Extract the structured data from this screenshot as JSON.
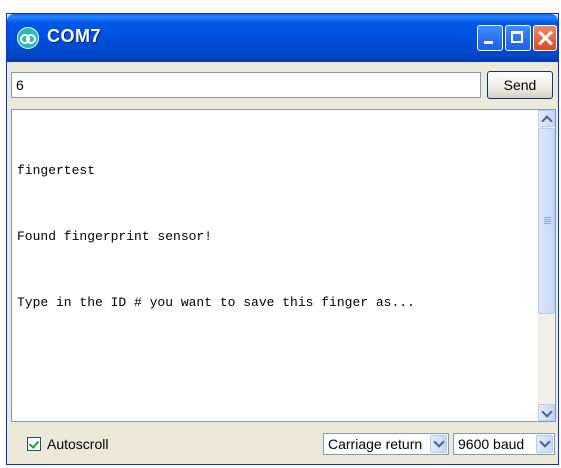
{
  "window": {
    "title": "COM7",
    "title_bar_color": "#0050dc"
  },
  "title_buttons": [
    {
      "name": "minimize",
      "icon": "minimize-icon"
    },
    {
      "name": "maximize",
      "icon": "maximize-icon"
    },
    {
      "name": "close",
      "icon": "close-icon"
    }
  ],
  "input": {
    "value": "6",
    "send_label": "Send"
  },
  "output": {
    "lines": [
      "fingertest",
      "Found fingerprint sensor!",
      "Type in the ID # you want to save this finger as..."
    ]
  },
  "footer": {
    "autoscroll_label": "Autoscroll",
    "autoscroll_checked": true,
    "line_ending": "Carriage return",
    "baud_rate": "9600 baud"
  }
}
